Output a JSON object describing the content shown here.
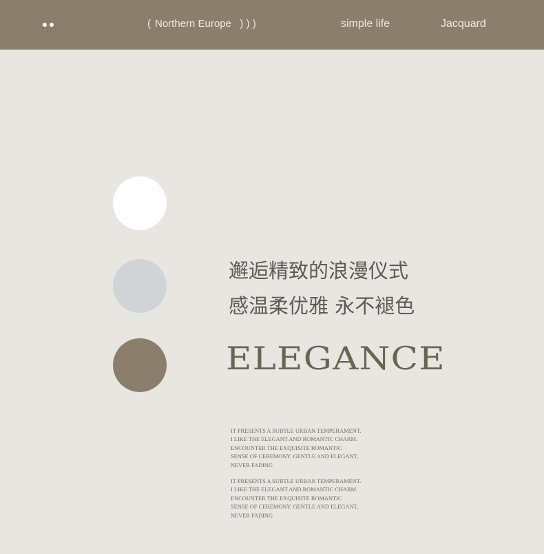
{
  "header": {
    "background": "#8a7f6c",
    "nav_open": "(",
    "nav_region": "Northern Europe",
    "nav_close": ") ) )",
    "nav_simple": "simple life",
    "nav_jacquard": "Jacquard"
  },
  "swatches": [
    {
      "color": "#ffffff"
    },
    {
      "color": "#d0d4d7"
    },
    {
      "color": "#8a7f6c"
    }
  ],
  "headline": {
    "line1": "邂逅精致的浪漫仪式",
    "line2": "感温柔优雅 永不褪色",
    "english": "ELEGANCE"
  },
  "paragraphs": [
    {
      "lines": [
        "IT PRESENTS A SUBTLE URBAN TEMPERAMENT.",
        "I LIKE THE ELEGANT AND ROMANTIC CHARM.",
        "ENCOUNTER THE EXQUISITE ROMANTIC",
        "SENSE OF CEREMONY. GENTLE AND ELEGANT,",
        "NEVER FADING"
      ]
    },
    {
      "lines": [
        "IT PRESENTS A SUBTLE URBAN TEMPERAMENT.",
        "I LIKE THE ELEGANT AND ROMANTIC CHARM.",
        "ENCOUNTER THE EXQUISITE ROMANTIC",
        "SENSE OF CEREMONY. GENTLE AND ELEGANT,",
        "NEVER FADING"
      ]
    }
  ]
}
